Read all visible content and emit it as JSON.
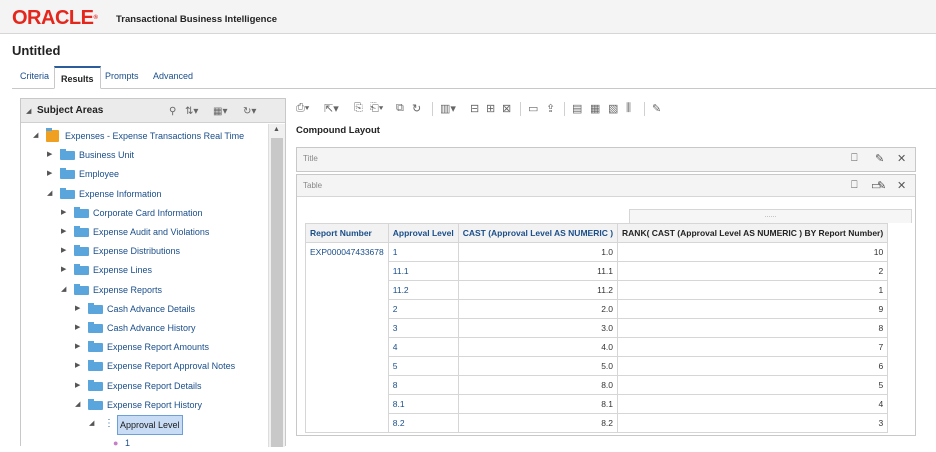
{
  "app": {
    "brand": "ORACLE",
    "product": "Transactional Business Intelligence",
    "document_title": "Untitled"
  },
  "tabs": [
    "Criteria",
    "Results",
    "Prompts",
    "Advanced"
  ],
  "subject_areas": {
    "title": "Subject Areas",
    "tree": [
      {
        "label": "Expenses - Expense Transactions Real Time",
        "level": 0,
        "expanded": true,
        "type": "cube"
      },
      {
        "label": "Business Unit",
        "level": 1,
        "expanded": false,
        "type": "folder"
      },
      {
        "label": "Employee",
        "level": 1,
        "expanded": false,
        "type": "folder"
      },
      {
        "label": "Expense Information",
        "level": 1,
        "expanded": true,
        "type": "folder"
      },
      {
        "label": "Corporate Card Information",
        "level": 2,
        "expanded": false,
        "type": "folder"
      },
      {
        "label": "Expense Audit and Violations",
        "level": 2,
        "expanded": false,
        "type": "folder"
      },
      {
        "label": "Expense Distributions",
        "level": 2,
        "expanded": false,
        "type": "folder"
      },
      {
        "label": "Expense Lines",
        "level": 2,
        "expanded": false,
        "type": "folder"
      },
      {
        "label": "Expense Reports",
        "level": 2,
        "expanded": true,
        "type": "folder"
      },
      {
        "label": "Cash Advance Details",
        "level": 3,
        "expanded": false,
        "type": "folder"
      },
      {
        "label": "Cash Advance History",
        "level": 3,
        "expanded": false,
        "type": "folder"
      },
      {
        "label": "Expense Report Amounts",
        "level": 3,
        "expanded": false,
        "type": "folder"
      },
      {
        "label": "Expense Report Approval Notes",
        "level": 3,
        "expanded": false,
        "type": "folder"
      },
      {
        "label": "Expense Report Details",
        "level": 3,
        "expanded": false,
        "type": "folder"
      },
      {
        "label": "Expense Report History",
        "level": 3,
        "expanded": true,
        "type": "folder"
      },
      {
        "label": "Approval Level",
        "level": 4,
        "expanded": true,
        "type": "hierarchy",
        "selected": true
      },
      {
        "label": "1",
        "level": 5,
        "type": "member"
      }
    ]
  },
  "compound_layout": {
    "title": "Compound Layout",
    "title_view_label": "Title",
    "table_view_label": "Table",
    "columns": [
      "Report Number",
      "Approval Level",
      "CAST (Approval Level AS NUMERIC )",
      "RANK( CAST (Approval Level AS NUMERIC ) BY Report Number)"
    ],
    "rank_header_mark": "......",
    "rows": [
      [
        "EXP000047433678",
        "1",
        "1.0",
        "10"
      ],
      [
        "",
        "11.1",
        "11.1",
        "2"
      ],
      [
        "",
        "11.2",
        "11.2",
        "1"
      ],
      [
        "",
        "2",
        "2.0",
        "9"
      ],
      [
        "",
        "3",
        "3.0",
        "8"
      ],
      [
        "",
        "4",
        "4.0",
        "7"
      ],
      [
        "",
        "5",
        "5.0",
        "6"
      ],
      [
        "",
        "8",
        "8.0",
        "5"
      ],
      [
        "",
        "8.1",
        "8.1",
        "4"
      ],
      [
        "",
        "8.2",
        "8.2",
        "3"
      ]
    ]
  }
}
